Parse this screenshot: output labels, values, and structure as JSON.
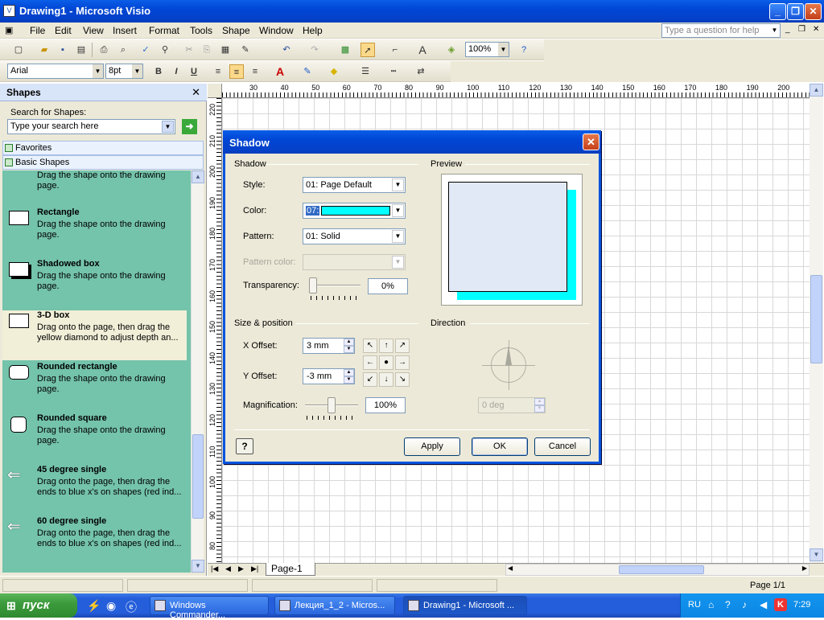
{
  "window": {
    "title": "Drawing1 - Microsoft Visio",
    "min": "_",
    "max": "❐",
    "close": "✕"
  },
  "menu": {
    "items": [
      "File",
      "Edit",
      "View",
      "Insert",
      "Format",
      "Tools",
      "Shape",
      "Window",
      "Help"
    ],
    "ask_placeholder": "Type a question for help"
  },
  "toolbar": {
    "zoom": "100%"
  },
  "format_toolbar": {
    "font": "Arial",
    "size": "8pt",
    "bold": "B",
    "italic": "I",
    "underline": "U"
  },
  "shapes_pane": {
    "title": "Shapes",
    "search_label": "Search for Shapes:",
    "search_placeholder": "Type your search here",
    "stencils": [
      "Favorites",
      "Basic Shapes"
    ],
    "items": [
      {
        "name": "",
        "desc": "Drag the shape onto the drawing page."
      },
      {
        "name": "Rectangle",
        "desc": "Drag the shape onto the drawing page."
      },
      {
        "name": "Shadowed box",
        "desc": "Drag the shape onto the drawing page."
      },
      {
        "name": "3-D box",
        "desc": "Drag onto the page, then drag the yellow diamond to adjust depth an..."
      },
      {
        "name": "Rounded rectangle",
        "desc": "Drag the shape onto the drawing page."
      },
      {
        "name": "Rounded square",
        "desc": "Drag the shape onto the drawing page."
      },
      {
        "name": "45 degree single",
        "desc": "Drag onto the page, then drag the ends to blue x's on shapes (red ind..."
      },
      {
        "name": "60 degree single",
        "desc": "Drag onto the page, then drag the ends to blue x's on shapes (red ind..."
      }
    ]
  },
  "ruler_top": [
    "30",
    "40",
    "50",
    "60",
    "70",
    "80",
    "90",
    "100",
    "110",
    "120",
    "130",
    "140",
    "150",
    "160",
    "170",
    "180",
    "190",
    "200"
  ],
  "ruler_left": [
    "220",
    "210",
    "200",
    "190",
    "180",
    "170",
    "160",
    "150",
    "140",
    "130",
    "120",
    "110",
    "100",
    "90",
    "80"
  ],
  "page_tab": "Page-1",
  "status": {
    "page": "Page 1/1"
  },
  "dialog": {
    "title": "Shadow",
    "shadow_group": "Shadow",
    "preview_group": "Preview",
    "style_label": "Style:",
    "style_value": "01: Page Default",
    "color_label": "Color:",
    "color_value": "07:",
    "color_swatch": "#00ffff",
    "pattern_label": "Pattern:",
    "pattern_value": "01: Solid",
    "pattern_color_label": "Pattern color:",
    "transparency_label": "Transparency:",
    "transparency_value": "0%",
    "size_group": "Size & position",
    "direction_group": "Direction",
    "x_offset_label": "X Offset:",
    "x_offset_value": "3 mm",
    "y_offset_label": "Y Offset:",
    "y_offset_value": "-3 mm",
    "magnification_label": "Magnification:",
    "magnification_value": "100%",
    "direction_value": "0 deg",
    "apply": "Apply",
    "ok": "OK",
    "cancel": "Cancel",
    "help": "?"
  },
  "taskbar": {
    "start": "пуск",
    "tasks": [
      "Windows Commander...",
      "Лекция_1_2 - Micros...",
      "Drawing1 - Microsoft ..."
    ],
    "lang": "RU",
    "clock": "7:29"
  }
}
